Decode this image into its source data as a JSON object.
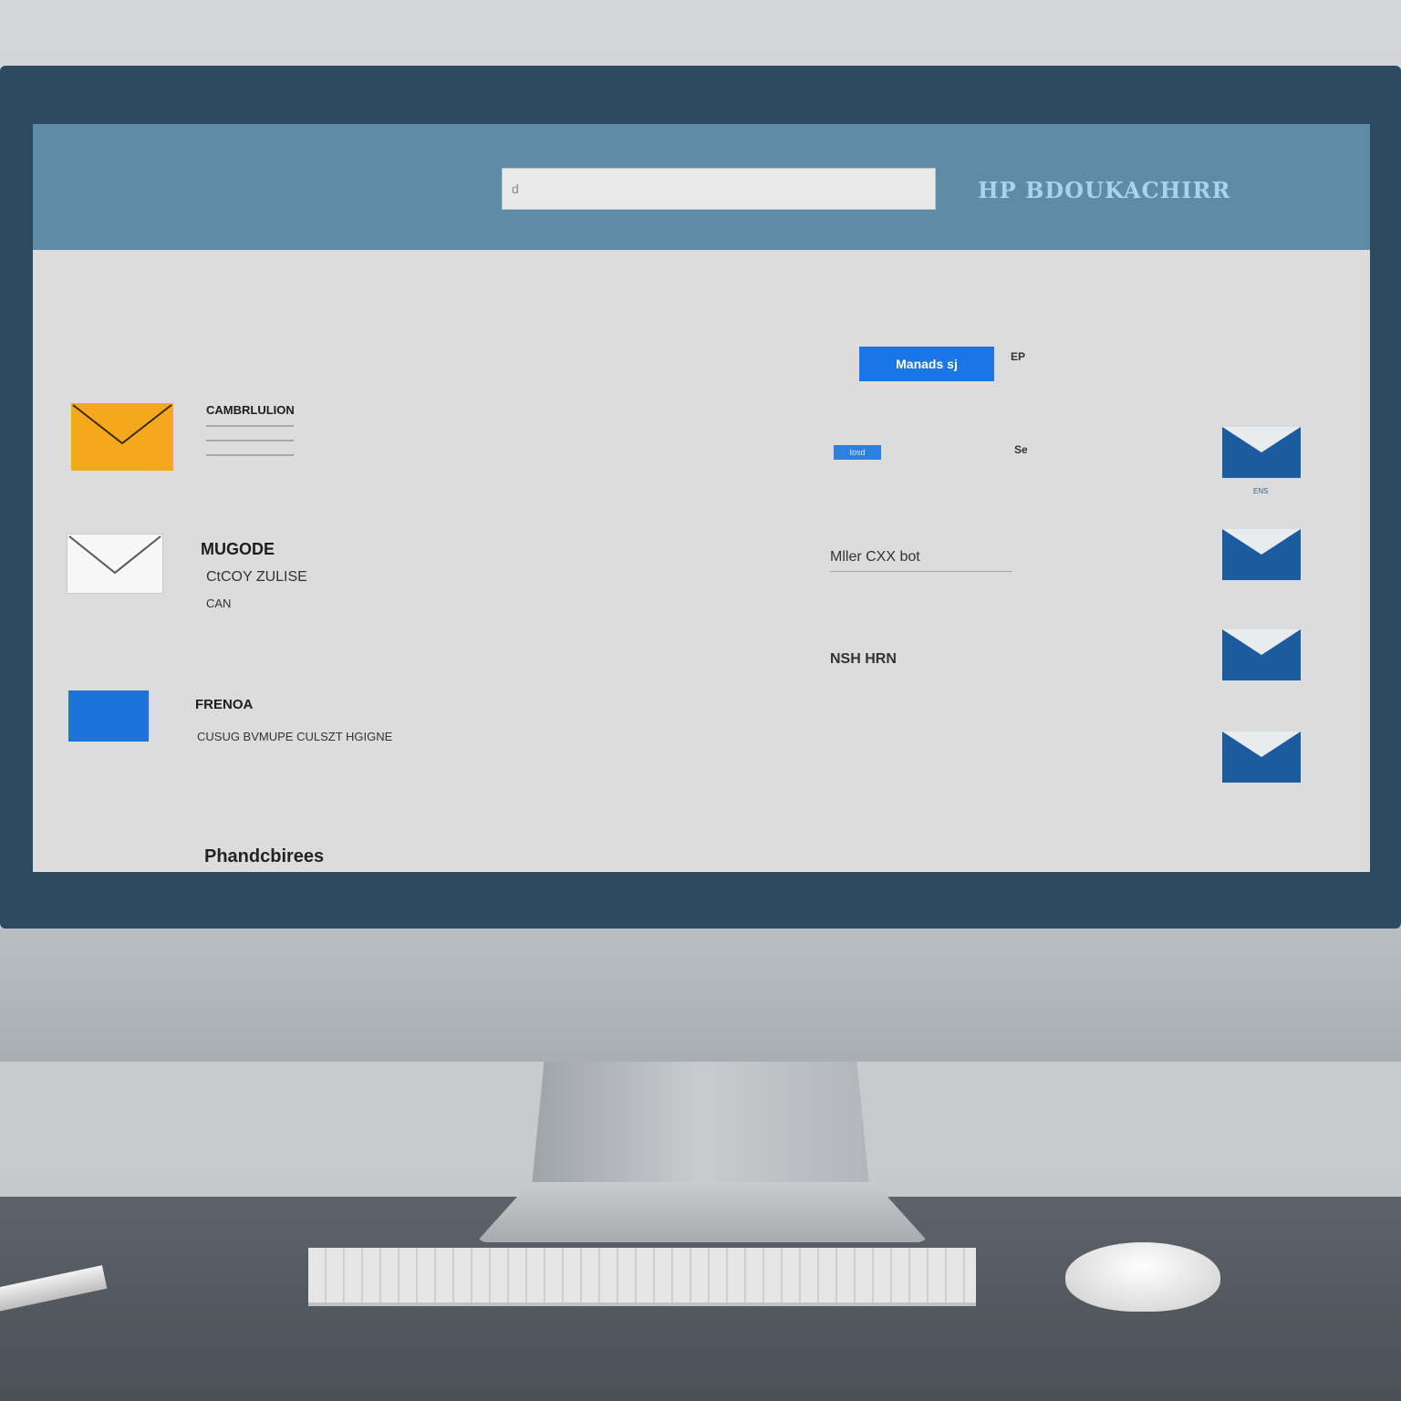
{
  "header": {
    "search_value": "d",
    "brand": "HP BDOUKACHIRR"
  },
  "toolbar": {
    "action_label": "Manads sj",
    "action_side_label": "EP"
  },
  "list": [
    {
      "title": "CAMBRLULION",
      "subtitle": "",
      "meta": ""
    },
    {
      "title": "MUGODE",
      "subtitle": "CtCOY ZULISE",
      "meta": "CAN"
    },
    {
      "title": "FRENOA",
      "subtitle": "CUSUG BVMUPE CULSZT HGIGNE",
      "meta": ""
    }
  ],
  "right_panel": {
    "tag_label": "Iosd",
    "tag_side_label": "Se",
    "line1": "Mller CXX bot",
    "line2": "NSH HRN",
    "envelope_label": "ENS"
  },
  "footer": {
    "link": "Phandcbirees"
  },
  "colors": {
    "topbar": "#5e8ca6",
    "accent": "#1a76e6",
    "bezel": "#2e4a63",
    "icon_yellow": "#f5a81c",
    "envelope_blue": "#1c5c9e"
  },
  "icons": [
    "envelope-icon",
    "search-icon"
  ]
}
